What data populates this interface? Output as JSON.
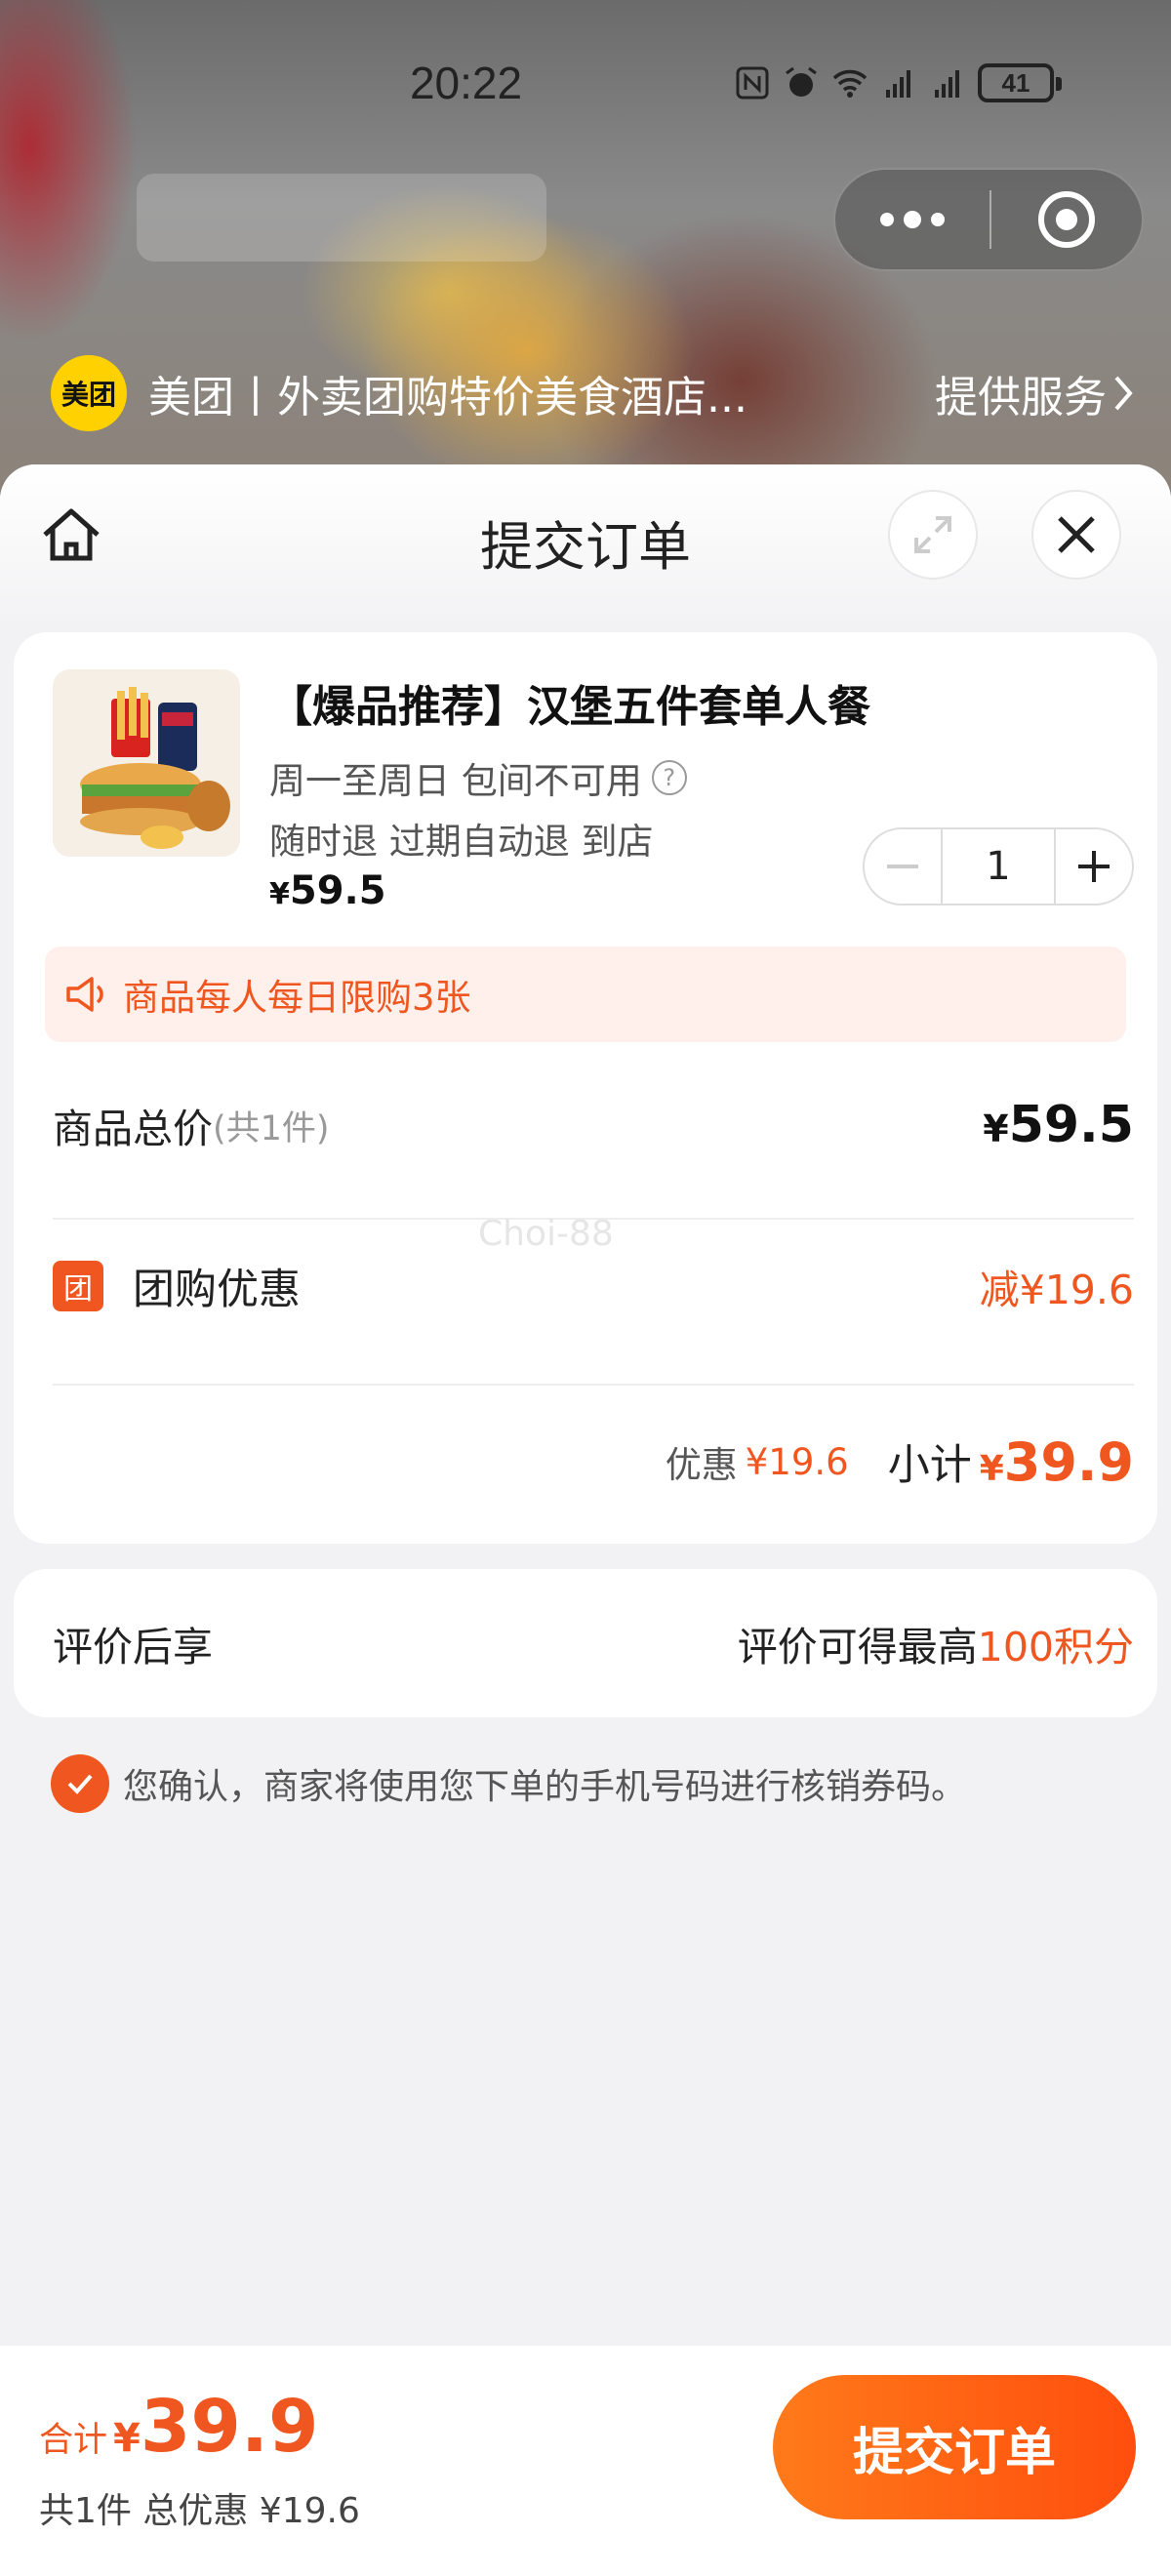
{
  "status_bar": {
    "time": "20:22",
    "battery": "41"
  },
  "mini_program": {
    "logo_text": "美团",
    "title": "美团丨外卖团购特价美食酒店...",
    "service_link": "提供服务"
  },
  "sheet": {
    "title": "提交订单"
  },
  "product": {
    "name": "【爆品推荐】汉堡五件套单人餐",
    "availability": "周一至周日 包间不可用",
    "help_icon": "?",
    "refund_policy": "随时退 过期自动退 到店",
    "price_yen": "¥",
    "price": "59.5",
    "quantity": "1"
  },
  "limit_notice": "商品每人每日限购3张",
  "summary": {
    "total_label": "商品总价",
    "total_count": "(共1件)",
    "total_yen": "¥",
    "total_value": "59.5",
    "watermark": "Choi-88",
    "group_badge": "团",
    "group_label": "团购优惠",
    "group_value": "减¥19.6",
    "discount_label": "优惠",
    "discount_value": "¥19.6",
    "subtotal_label": "小计",
    "subtotal_yen": "¥",
    "subtotal_value": "39.9"
  },
  "review": {
    "label": "评价后享",
    "text": "评价可得最高",
    "points": "100积分"
  },
  "confirm_text": "您确认，商家将使用您下单的手机号码进行核销券码。",
  "bottom": {
    "sum_label": "合计",
    "sum_yen": "¥",
    "sum_value": "39.9",
    "sub_text": "共1件 总优惠 ¥19.6",
    "submit_label": "提交订单"
  },
  "colors": {
    "accent": "#f0561f",
    "brand_yellow": "#ffd100"
  }
}
